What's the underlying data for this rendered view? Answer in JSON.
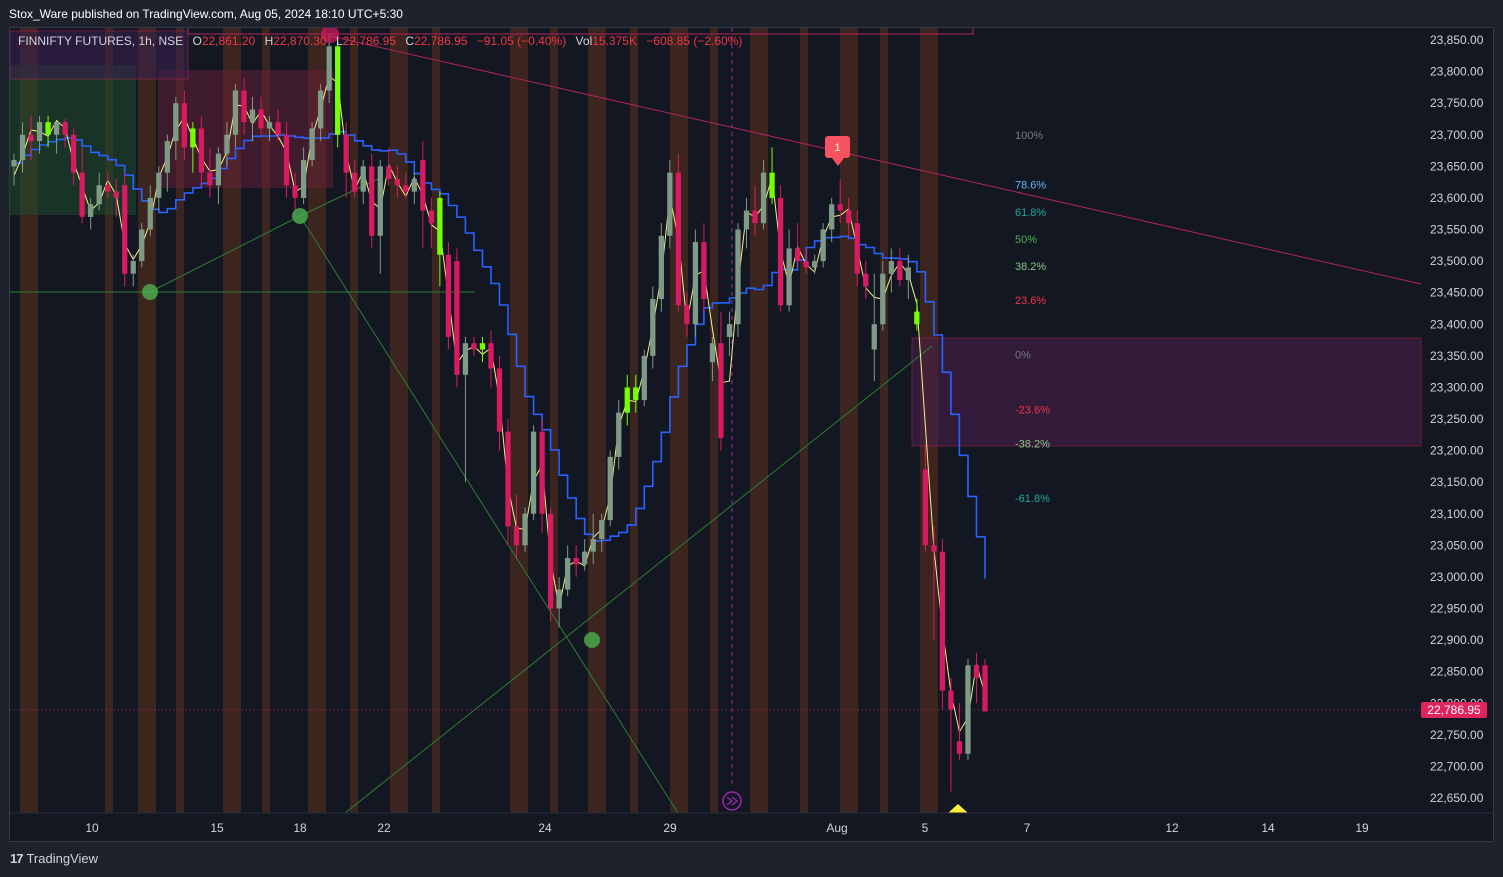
{
  "header": {
    "publish_line": "Stox_Ware published on TradingView.com, Aug 05, 2024 18:10 UTC+5:30"
  },
  "legend": {
    "symbol": "FINNIFTY FUTURES, 1h, NSE",
    "o_label": "O",
    "o": "22,861.20",
    "h_label": "H",
    "h": "22,870.30",
    "l_label": "L",
    "l": "22,786.95",
    "c_label": "C",
    "c": "22,786.95",
    "change": "−91.05 (−0.40%)",
    "vol_label": "Vol",
    "vol": "15.375K",
    "vol_change": "−608.85 (−2.60%)"
  },
  "last_price": "22,786.95",
  "brand": {
    "logo": "17",
    "name": "TradingView"
  },
  "signal_label": "1",
  "colors": {
    "background": "#131722",
    "up": "#7f9a87",
    "down": "#d81b60",
    "bull_signal": "#76ff03",
    "fast_line": "#f5f28a",
    "slow_line": "#2962ff",
    "band": "#4a2b1e",
    "trend_pink": "#b0245e",
    "trend_green": "#2e7d32",
    "fib_box": "#4a1f4a"
  },
  "chart_data": {
    "type": "candlestick",
    "symbol": "FINNIFTY FUTURES",
    "interval": "1h",
    "y_ticks": [
      "23,850.00",
      "23,800.00",
      "23,750.00",
      "23,700.00",
      "23,650.00",
      "23,600.00",
      "23,550.00",
      "23,500.00",
      "23,450.00",
      "23,400.00",
      "23,350.00",
      "23,300.00",
      "23,250.00",
      "23,200.00",
      "23,150.00",
      "23,100.00",
      "23,050.00",
      "23,000.00",
      "22,950.00",
      "22,900.00",
      "22,850.00",
      "22,800.00",
      "22,750.00",
      "22,700.00",
      "22,650.00"
    ],
    "x_ticks": [
      "10",
      "15",
      "18",
      "22",
      "24",
      "29",
      "Aug",
      "5",
      "7",
      "12",
      "14",
      "19"
    ],
    "ylim": [
      22620,
      23870
    ],
    "fib_levels": [
      {
        "label": "100%",
        "price": 23700,
        "color": "#787b86"
      },
      {
        "label": "78.6%",
        "price": 23621,
        "color": "#64b5f6"
      },
      {
        "label": "61.8%",
        "price": 23578,
        "color": "#26a69a"
      },
      {
        "label": "50%",
        "price": 23535,
        "color": "#4caf50"
      },
      {
        "label": "38.2%",
        "price": 23492,
        "color": "#81c784"
      },
      {
        "label": "23.6%",
        "price": 23438,
        "color": "#f23645"
      },
      {
        "label": "0%",
        "price": 23352,
        "color": "#787b86"
      },
      {
        "label": "-23.6%",
        "price": 23265,
        "color": "#f23645"
      },
      {
        "label": "-38.2%",
        "price": 23211,
        "color": "#81c784"
      },
      {
        "label": "-61.8%",
        "price": 23125,
        "color": "#26a69a"
      }
    ],
    "candles": [
      {
        "o": 23650,
        "h": 23670,
        "l": 23620,
        "c": 23660
      },
      {
        "o": 23660,
        "h": 23720,
        "l": 23640,
        "c": 23700
      },
      {
        "o": 23700,
        "h": 23730,
        "l": 23660,
        "c": 23690
      },
      {
        "o": 23690,
        "h": 23730,
        "l": 23670,
        "c": 23720
      },
      {
        "o": 23720,
        "h": 23730,
        "l": 23680,
        "c": 23700
      },
      {
        "o": 23700,
        "h": 23720,
        "l": 23670,
        "c": 23720
      },
      {
        "o": 23720,
        "h": 23725,
        "l": 23680,
        "c": 23700
      },
      {
        "o": 23700,
        "h": 23710,
        "l": 23620,
        "c": 23640
      },
      {
        "o": 23640,
        "h": 23680,
        "l": 23560,
        "c": 23570
      },
      {
        "o": 23570,
        "h": 23600,
        "l": 23550,
        "c": 23590
      },
      {
        "o": 23590,
        "h": 23640,
        "l": 23580,
        "c": 23620
      },
      {
        "o": 23620,
        "h": 23640,
        "l": 23600,
        "c": 23610
      },
      {
        "o": 23610,
        "h": 23630,
        "l": 23570,
        "c": 23600
      },
      {
        "o": 23620,
        "h": 23640,
        "l": 23460,
        "c": 23480
      },
      {
        "o": 23480,
        "h": 23510,
        "l": 23460,
        "c": 23500
      },
      {
        "o": 23500,
        "h": 23560,
        "l": 23490,
        "c": 23550
      },
      {
        "o": 23550,
        "h": 23620,
        "l": 23540,
        "c": 23600
      },
      {
        "o": 23600,
        "h": 23650,
        "l": 23580,
        "c": 23640
      },
      {
        "o": 23640,
        "h": 23700,
        "l": 23610,
        "c": 23690
      },
      {
        "o": 23690,
        "h": 23760,
        "l": 23660,
        "c": 23750
      },
      {
        "o": 23750,
        "h": 23770,
        "l": 23660,
        "c": 23680
      },
      {
        "o": 23680,
        "h": 23720,
        "l": 23640,
        "c": 23710
      },
      {
        "o": 23710,
        "h": 23730,
        "l": 23620,
        "c": 23640
      },
      {
        "o": 23640,
        "h": 23680,
        "l": 23600,
        "c": 23620
      },
      {
        "o": 23620,
        "h": 23680,
        "l": 23590,
        "c": 23670
      },
      {
        "o": 23670,
        "h": 23720,
        "l": 23650,
        "c": 23700
      },
      {
        "o": 23700,
        "h": 23780,
        "l": 23680,
        "c": 23770
      },
      {
        "o": 23770,
        "h": 23790,
        "l": 23700,
        "c": 23720
      },
      {
        "o": 23720,
        "h": 23760,
        "l": 23690,
        "c": 23740
      },
      {
        "o": 23740,
        "h": 23760,
        "l": 23700,
        "c": 23710
      },
      {
        "o": 23710,
        "h": 23730,
        "l": 23690,
        "c": 23720
      },
      {
        "o": 23720,
        "h": 23740,
        "l": 23690,
        "c": 23700
      },
      {
        "o": 23700,
        "h": 23720,
        "l": 23600,
        "c": 23620
      },
      {
        "o": 23620,
        "h": 23640,
        "l": 23570,
        "c": 23600
      },
      {
        "o": 23600,
        "h": 23680,
        "l": 23590,
        "c": 23660
      },
      {
        "o": 23660,
        "h": 23720,
        "l": 23650,
        "c": 23710
      },
      {
        "o": 23710,
        "h": 23780,
        "l": 23690,
        "c": 23770
      },
      {
        "o": 23770,
        "h": 23860,
        "l": 23750,
        "c": 23840
      },
      {
        "o": 23840,
        "h": 23850,
        "l": 23680,
        "c": 23700
      },
      {
        "o": 23700,
        "h": 23720,
        "l": 23600,
        "c": 23640
      },
      {
        "o": 23640,
        "h": 23660,
        "l": 23600,
        "c": 23610
      },
      {
        "o": 23610,
        "h": 23660,
        "l": 23590,
        "c": 23650
      },
      {
        "o": 23650,
        "h": 23670,
        "l": 23520,
        "c": 23540
      },
      {
        "o": 23540,
        "h": 23660,
        "l": 23480,
        "c": 23650
      },
      {
        "o": 23650,
        "h": 23680,
        "l": 23620,
        "c": 23630
      },
      {
        "o": 23630,
        "h": 23650,
        "l": 23600,
        "c": 23620
      },
      {
        "o": 23620,
        "h": 23640,
        "l": 23600,
        "c": 23610
      },
      {
        "o": 23610,
        "h": 23640,
        "l": 23590,
        "c": 23630
      },
      {
        "o": 23660,
        "h": 23690,
        "l": 23520,
        "c": 23580
      },
      {
        "o": 23580,
        "h": 23600,
        "l": 23520,
        "c": 23560
      },
      {
        "o": 23600,
        "h": 23610,
        "l": 23460,
        "c": 23510
      },
      {
        "o": 23510,
        "h": 23530,
        "l": 23360,
        "c": 23380
      },
      {
        "o": 23500,
        "h": 23520,
        "l": 23300,
        "c": 23320
      },
      {
        "o": 23320,
        "h": 23380,
        "l": 23150,
        "c": 23370
      },
      {
        "o": 23370,
        "h": 23380,
        "l": 23350,
        "c": 23360
      },
      {
        "o": 23360,
        "h": 23380,
        "l": 23340,
        "c": 23370
      },
      {
        "o": 23370,
        "h": 23390,
        "l": 23300,
        "c": 23330
      },
      {
        "o": 23330,
        "h": 23350,
        "l": 23200,
        "c": 23230
      },
      {
        "o": 23230,
        "h": 23250,
        "l": 23050,
        "c": 23080
      },
      {
        "o": 23080,
        "h": 23130,
        "l": 23030,
        "c": 23050
      },
      {
        "o": 23050,
        "h": 23110,
        "l": 23040,
        "c": 23100
      },
      {
        "o": 23100,
        "h": 23240,
        "l": 23090,
        "c": 23230
      },
      {
        "o": 23230,
        "h": 23250,
        "l": 23070,
        "c": 23100
      },
      {
        "o": 23100,
        "h": 23110,
        "l": 22930,
        "c": 22950
      },
      {
        "o": 22950,
        "h": 23000,
        "l": 22920,
        "c": 22980
      },
      {
        "o": 22980,
        "h": 23050,
        "l": 22970,
        "c": 23030
      },
      {
        "o": 23030,
        "h": 23050,
        "l": 23000,
        "c": 23020
      },
      {
        "o": 23020,
        "h": 23060,
        "l": 23010,
        "c": 23040
      },
      {
        "o": 23040,
        "h": 23100,
        "l": 23020,
        "c": 23060
      },
      {
        "o": 23060,
        "h": 23100,
        "l": 23040,
        "c": 23090
      },
      {
        "o": 23090,
        "h": 23200,
        "l": 23080,
        "c": 23190
      },
      {
        "o": 23190,
        "h": 23280,
        "l": 23170,
        "c": 23260
      },
      {
        "o": 23260,
        "h": 23320,
        "l": 23240,
        "c": 23300
      },
      {
        "o": 23300,
        "h": 23320,
        "l": 23260,
        "c": 23280
      },
      {
        "o": 23280,
        "h": 23360,
        "l": 23270,
        "c": 23350
      },
      {
        "o": 23350,
        "h": 23460,
        "l": 23330,
        "c": 23440
      },
      {
        "o": 23440,
        "h": 23560,
        "l": 23420,
        "c": 23540
      },
      {
        "o": 23540,
        "h": 23660,
        "l": 23520,
        "c": 23640
      },
      {
        "o": 23640,
        "h": 23670,
        "l": 23420,
        "c": 23430
      },
      {
        "o": 23430,
        "h": 23450,
        "l": 23380,
        "c": 23400
      },
      {
        "o": 23400,
        "h": 23550,
        "l": 23380,
        "c": 23530
      },
      {
        "o": 23530,
        "h": 23560,
        "l": 23420,
        "c": 23440
      },
      {
        "o": 23340,
        "h": 23380,
        "l": 23310,
        "c": 23370
      },
      {
        "o": 23370,
        "h": 23420,
        "l": 23200,
        "c": 23220
      },
      {
        "o": 23380,
        "h": 23420,
        "l": 23350,
        "c": 23400
      },
      {
        "o": 23400,
        "h": 23560,
        "l": 23380,
        "c": 23550
      },
      {
        "o": 23550,
        "h": 23600,
        "l": 23520,
        "c": 23580
      },
      {
        "o": 23580,
        "h": 23620,
        "l": 23540,
        "c": 23560
      },
      {
        "o": 23560,
        "h": 23660,
        "l": 23550,
        "c": 23640
      },
      {
        "o": 23640,
        "h": 23680,
        "l": 23590,
        "c": 23600
      },
      {
        "o": 23600,
        "h": 23620,
        "l": 23420,
        "c": 23430
      },
      {
        "o": 23430,
        "h": 23550,
        "l": 23420,
        "c": 23520
      },
      {
        "o": 23520,
        "h": 23560,
        "l": 23490,
        "c": 23500
      },
      {
        "o": 23500,
        "h": 23520,
        "l": 23480,
        "c": 23490
      },
      {
        "o": 23490,
        "h": 23510,
        "l": 23480,
        "c": 23500
      },
      {
        "o": 23500,
        "h": 23560,
        "l": 23490,
        "c": 23550
      },
      {
        "o": 23550,
        "h": 23600,
        "l": 23530,
        "c": 23590
      },
      {
        "o": 23590,
        "h": 23630,
        "l": 23560,
        "c": 23580
      },
      {
        "o": 23580,
        "h": 23600,
        "l": 23540,
        "c": 23560
      },
      {
        "o": 23560,
        "h": 23580,
        "l": 23460,
        "c": 23480
      },
      {
        "o": 23480,
        "h": 23500,
        "l": 23440,
        "c": 23460
      },
      {
        "o": 23360,
        "h": 23480,
        "l": 23310,
        "c": 23400
      },
      {
        "o": 23400,
        "h": 23500,
        "l": 23390,
        "c": 23480
      },
      {
        "o": 23480,
        "h": 23520,
        "l": 23450,
        "c": 23500
      },
      {
        "o": 23500,
        "h": 23520,
        "l": 23460,
        "c": 23470
      },
      {
        "o": 23470,
        "h": 23510,
        "l": 23440,
        "c": 23490
      },
      {
        "o": 23420,
        "h": 23440,
        "l": 23390,
        "c": 23400
      },
      {
        "o": 23170,
        "h": 23210,
        "l": 23040,
        "c": 23050
      },
      {
        "o": 23050,
        "h": 23080,
        "l": 22900,
        "c": 23040
      },
      {
        "o": 23040,
        "h": 23060,
        "l": 22790,
        "c": 22820
      },
      {
        "o": 22820,
        "h": 22840,
        "l": 22660,
        "c": 22790
      },
      {
        "o": 22740,
        "h": 22800,
        "l": 22710,
        "c": 22720
      },
      {
        "o": 22720,
        "h": 22870,
        "l": 22710,
        "c": 22860
      },
      {
        "o": 22860,
        "h": 22880,
        "l": 22800,
        "c": 22840
      },
      {
        "o": 22860,
        "h": 22870,
        "l": 22787,
        "c": 22787
      }
    ]
  }
}
